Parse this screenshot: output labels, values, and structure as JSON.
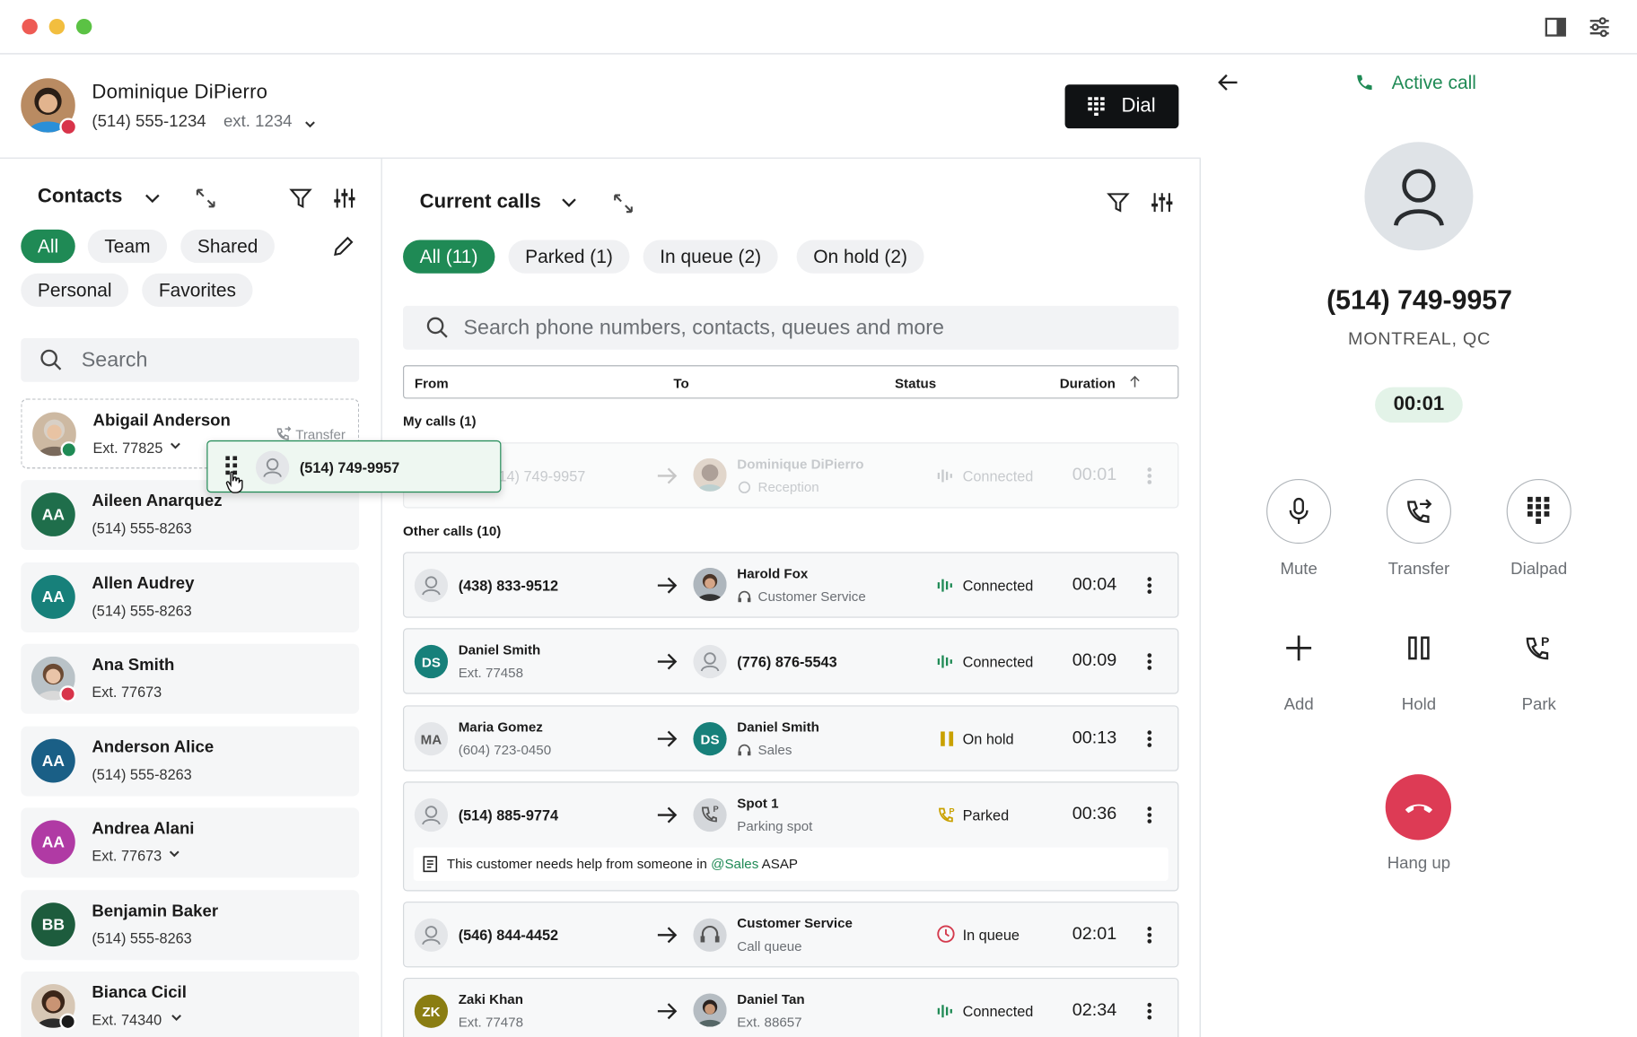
{
  "user": {
    "name": "Dominique DiPierro",
    "phone": "(514) 555-1234",
    "ext": "ext. 1234",
    "dial_label": "Dial"
  },
  "contacts": {
    "title": "Contacts",
    "filters": [
      "All",
      "Team",
      "Shared",
      "Personal",
      "Favorites"
    ],
    "search_placeholder": "Search",
    "transfer_hint": "Transfer",
    "dragging_number": "(514) 749-9957",
    "items": [
      {
        "name": "Abigail Anderson",
        "sub": "Ext. 77825",
        "initials": "",
        "color": ""
      },
      {
        "name": "Aileen Anarquez",
        "sub": "(514) 555-8263",
        "initials": "AA",
        "color": "#1f6e4b"
      },
      {
        "name": "Allen Audrey",
        "sub": "(514) 555-8263",
        "initials": "AA",
        "color": "#17807a"
      },
      {
        "name": "Ana Smith",
        "sub": "Ext. 77673",
        "initials": "",
        "color": ""
      },
      {
        "name": "Anderson Alice",
        "sub": "(514) 555-8263",
        "initials": "AA",
        "color": "#1a5f86"
      },
      {
        "name": "Andrea Alani",
        "sub": "Ext. 77673",
        "initials": "AA",
        "color": "#b03aa4"
      },
      {
        "name": "Benjamin Baker",
        "sub": "(514) 555-8263",
        "initials": "BB",
        "color": "#1d5c3d"
      },
      {
        "name": "Bianca Cicil",
        "sub": "Ext. 74340",
        "initials": "",
        "color": ""
      }
    ]
  },
  "calls": {
    "title": "Current calls",
    "filters": [
      "All (11)",
      "Parked (1)",
      "In queue (2)",
      "On hold (2)"
    ],
    "search_placeholder": "Search phone numbers, contacts, queues and more",
    "columns": {
      "from": "From",
      "to": "To",
      "status": "Status",
      "duration": "Duration"
    },
    "my_calls_label": "My calls (1)",
    "other_calls_label": "Other calls (10)",
    "my_call": {
      "from": "(514) 749-9957",
      "to": "Dominique DiPierro",
      "to_sub": "Reception",
      "status": "Connected",
      "duration": "00:01"
    },
    "rows": [
      {
        "from": "(438) 833-9512",
        "from_sub": "",
        "from_initials": "",
        "from_color": "",
        "to": "Harold Fox",
        "to_sub": "Customer Service",
        "to_initials": "",
        "status": "Connected",
        "duration": "00:04"
      },
      {
        "from": "Daniel Smith",
        "from_sub": "Ext. 77458",
        "from_initials": "DS",
        "from_color": "#17807a",
        "to": "(776) 876-5543",
        "to_sub": "",
        "to_initials": "",
        "status": "Connected",
        "duration": "00:09"
      },
      {
        "from": "Maria Gomez",
        "from_sub": "(604) 723-0450",
        "from_initials": "MA",
        "from_color": "#e4e6e9",
        "to": "Daniel Smith",
        "to_sub": "Sales",
        "to_initials": "DS",
        "status": "On hold",
        "duration": "00:13"
      },
      {
        "from": "(514) 885-9774",
        "from_sub": "",
        "from_initials": "",
        "from_color": "",
        "to": "Spot 1",
        "to_sub": "Parking spot",
        "to_initials": "",
        "status": "Parked",
        "duration": "00:36"
      },
      {
        "from": "(546) 844-4452",
        "from_sub": "",
        "from_initials": "",
        "from_color": "",
        "to": "Customer Service",
        "to_sub": "Call queue",
        "to_initials": "",
        "status": "In queue",
        "duration": "02:01"
      },
      {
        "from": "Zaki Khan",
        "from_sub": "Ext. 77478",
        "from_initials": "ZK",
        "from_color": "#8a7d12",
        "to": "Daniel Tan",
        "to_sub": "Ext. 88657",
        "to_initials": "",
        "status": "Connected",
        "duration": "02:34"
      }
    ],
    "note": {
      "prefix": "This customer needs help from someone in ",
      "mention": "@Sales",
      "suffix": " ASAP"
    }
  },
  "active_call": {
    "label": "Active call",
    "number": "(514) 749-9957",
    "location": "MONTREAL, QC",
    "timer": "00:01",
    "actions": [
      "Mute",
      "Transfer",
      "Dialpad",
      "Add",
      "Hold",
      "Park"
    ],
    "hang_up": "Hang up"
  },
  "colors": {
    "accent": "#1f8a55",
    "hang_up": "#dd3b55",
    "hold": "#c9a100",
    "parked": "#c9a100",
    "queue": "#d43a4d"
  }
}
